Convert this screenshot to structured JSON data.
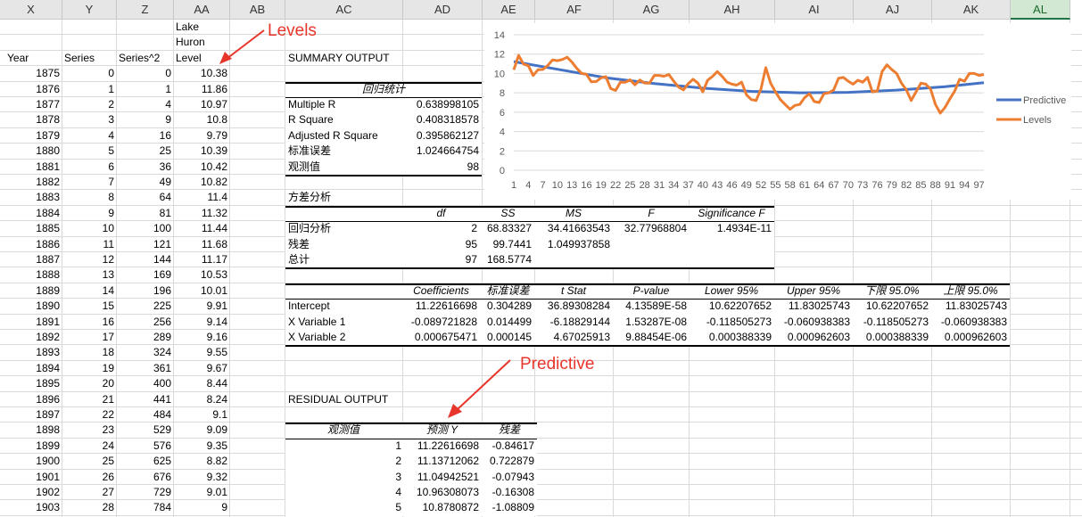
{
  "columns": [
    "X",
    "Y",
    "Z",
    "AA",
    "AB",
    "AC",
    "AD",
    "AE",
    "AF",
    "AG",
    "AH",
    "AI",
    "AJ",
    "AK",
    "AL"
  ],
  "selected_column": "AL",
  "data_header": {
    "year": "Year",
    "series": "Series",
    "series_sq": "Series^2",
    "level_l1": "Lake",
    "level_l2": "Huron",
    "level_l3": "Level"
  },
  "data_rows": [
    [
      "1875",
      "0",
      "0",
      "10.38"
    ],
    [
      "1876",
      "1",
      "1",
      "11.86"
    ],
    [
      "1877",
      "2",
      "4",
      "10.97"
    ],
    [
      "1878",
      "3",
      "9",
      "10.8"
    ],
    [
      "1879",
      "4",
      "16",
      "9.79"
    ],
    [
      "1880",
      "5",
      "25",
      "10.39"
    ],
    [
      "1881",
      "6",
      "36",
      "10.42"
    ],
    [
      "1882",
      "7",
      "49",
      "10.82"
    ],
    [
      "1883",
      "8",
      "64",
      "11.4"
    ],
    [
      "1884",
      "9",
      "81",
      "11.32"
    ],
    [
      "1885",
      "10",
      "100",
      "11.44"
    ],
    [
      "1886",
      "11",
      "121",
      "11.68"
    ],
    [
      "1887",
      "12",
      "144",
      "11.17"
    ],
    [
      "1888",
      "13",
      "169",
      "10.53"
    ],
    [
      "1889",
      "14",
      "196",
      "10.01"
    ],
    [
      "1890",
      "15",
      "225",
      "9.91"
    ],
    [
      "1891",
      "16",
      "256",
      "9.14"
    ],
    [
      "1892",
      "17",
      "289",
      "9.16"
    ],
    [
      "1893",
      "18",
      "324",
      "9.55"
    ],
    [
      "1894",
      "19",
      "361",
      "9.67"
    ],
    [
      "1895",
      "20",
      "400",
      "8.44"
    ],
    [
      "1896",
      "21",
      "441",
      "8.24"
    ],
    [
      "1897",
      "22",
      "484",
      "9.1"
    ],
    [
      "1898",
      "23",
      "529",
      "9.09"
    ],
    [
      "1899",
      "24",
      "576",
      "9.35"
    ],
    [
      "1900",
      "25",
      "625",
      "8.82"
    ],
    [
      "1901",
      "26",
      "676",
      "9.32"
    ],
    [
      "1902",
      "27",
      "729",
      "9.01"
    ],
    [
      "1903",
      "28",
      "784",
      "9"
    ]
  ],
  "summary": {
    "title": "SUMMARY OUTPUT",
    "reg_stats_header": "回归统计",
    "reg_stats": [
      [
        "Multiple R",
        "0.638998105"
      ],
      [
        "R Square",
        "0.408318578"
      ],
      [
        "Adjusted R Square",
        "0.395862127"
      ],
      [
        "标准误差",
        "1.024664754"
      ],
      [
        "观测值",
        "98"
      ]
    ],
    "anova_title": "方差分析",
    "anova_headers": [
      "df",
      "SS",
      "MS",
      "F",
      "Significance F"
    ],
    "anova_rows": [
      {
        "label": "回归分析",
        "df": "2",
        "ss": "68.83327",
        "ms": "34.41663543",
        "f": "32.77968804",
        "sig": "1.4934E-11"
      },
      {
        "label": "残差",
        "df": "95",
        "ss": "99.7441",
        "ms": "1.049937858",
        "f": "",
        "sig": ""
      },
      {
        "label": "总计",
        "df": "97",
        "ss": "168.5774",
        "ms": "",
        "f": "",
        "sig": ""
      }
    ],
    "coef_headers": [
      "Coefficients",
      "标准误差",
      "t Stat",
      "P-value",
      "Lower 95%",
      "Upper 95%",
      "下限 95.0%",
      "上限 95.0%"
    ],
    "coef_rows": [
      [
        "Intercept",
        "11.22616698",
        "0.304289",
        "36.89308284",
        "4.13589E-58",
        "10.62207652",
        "11.83025743",
        "10.62207652",
        "11.83025743"
      ],
      [
        "X Variable 1",
        "-0.089721828",
        "0.014499",
        "-6.18829144",
        "1.53287E-08",
        "-0.118505273",
        "-0.060938383",
        "-0.118505273",
        "-0.060938383"
      ],
      [
        "X Variable 2",
        "0.000675471",
        "0.000145",
        "4.67025913",
        "9.88454E-06",
        "0.000388339",
        "0.000962603",
        "0.000388339",
        "0.000962603"
      ]
    ],
    "residual_title": "RESIDUAL OUTPUT",
    "residual_headers": [
      "观测值",
      "预测 Y",
      "残差"
    ],
    "residual_rows": [
      [
        "1",
        "11.22616698",
        "-0.84617"
      ],
      [
        "2",
        "11.13712062",
        "0.722879"
      ],
      [
        "3",
        "11.04942521",
        "-0.07943"
      ],
      [
        "4",
        "10.96308073",
        "-0.16308"
      ],
      [
        "5",
        "10.8780872",
        "-1.08809"
      ]
    ]
  },
  "annotations": {
    "levels": "Levels",
    "predictive": "Predictive"
  },
  "colors": {
    "predictive": "#4472c4",
    "levels": "#ed7d31",
    "annotation": "#e8352b"
  },
  "chart_data": {
    "type": "line",
    "x_tick_labels": [
      "1",
      "4",
      "7",
      "10",
      "13",
      "16",
      "19",
      "22",
      "25",
      "28",
      "31",
      "34",
      "37",
      "40",
      "43",
      "46",
      "49",
      "52",
      "55",
      "58",
      "61",
      "64",
      "67",
      "70",
      "73",
      "76",
      "79",
      "82",
      "85",
      "88",
      "91",
      "94",
      "97"
    ],
    "ylim": [
      0,
      14
    ],
    "yticks": [
      0,
      2,
      4,
      6,
      8,
      10,
      12,
      14
    ],
    "legend_position": "right",
    "gridlines": true,
    "series": [
      {
        "name": "Predictive",
        "color": "#4472c4",
        "x": [
          1,
          10,
          20,
          30,
          40,
          50,
          60,
          70,
          80,
          90,
          98
        ],
        "values": [
          11.23,
          10.44,
          9.56,
          8.96,
          8.48,
          8.15,
          8.0,
          8.05,
          8.28,
          8.64,
          9.05
        ]
      },
      {
        "name": "Levels",
        "color": "#ed7d31",
        "x": [
          1,
          2,
          3,
          4,
          5,
          6,
          7,
          8,
          9,
          10,
          11,
          12,
          13,
          14,
          15,
          16,
          17,
          18,
          19,
          20,
          21,
          22,
          23,
          24,
          25,
          26,
          27,
          28,
          29,
          30,
          31,
          32,
          33,
          34,
          35,
          36,
          37,
          38,
          39,
          40,
          41,
          42,
          43,
          44,
          45,
          46,
          47,
          48,
          49,
          50,
          51,
          52,
          53,
          54,
          55,
          56,
          57,
          58,
          59,
          60,
          61,
          62,
          63,
          64,
          65,
          66,
          67,
          68,
          69,
          70,
          71,
          72,
          73,
          74,
          75,
          76,
          77,
          78,
          79,
          80,
          81,
          82,
          83,
          84,
          85,
          86,
          87,
          88,
          89,
          90,
          91,
          92,
          93,
          94,
          95,
          96,
          97,
          98
        ],
        "values": [
          10.38,
          11.86,
          10.97,
          10.8,
          9.79,
          10.39,
          10.42,
          10.82,
          11.4,
          11.32,
          11.44,
          11.68,
          11.17,
          10.53,
          10.01,
          9.91,
          9.14,
          9.16,
          9.55,
          9.67,
          8.44,
          8.24,
          9.1,
          9.09,
          9.35,
          8.82,
          9.32,
          9.01,
          9.0,
          9.8,
          9.8,
          9.72,
          9.89,
          9.2,
          8.6,
          8.3,
          8.95,
          9.4,
          9.0,
          8.1,
          9.3,
          9.7,
          10.2,
          9.7,
          9.1,
          8.9,
          8.8,
          9.1,
          7.8,
          7.3,
          7.2,
          8.4,
          10.6,
          9.0,
          8.1,
          7.3,
          6.8,
          6.3,
          6.7,
          6.8,
          7.5,
          7.9,
          7.1,
          7.0,
          7.9,
          8.0,
          8.3,
          9.5,
          9.6,
          9.2,
          8.9,
          9.3,
          9.1,
          9.6,
          8.1,
          8.2,
          10.2,
          10.9,
          10.4,
          10.0,
          9.0,
          8.3,
          7.2,
          8.1,
          9.0,
          8.9,
          8.4,
          6.8,
          5.9,
          6.5,
          7.4,
          8.2,
          9.4,
          9.2,
          10.0,
          10.0,
          9.8,
          9.9
        ]
      }
    ]
  }
}
